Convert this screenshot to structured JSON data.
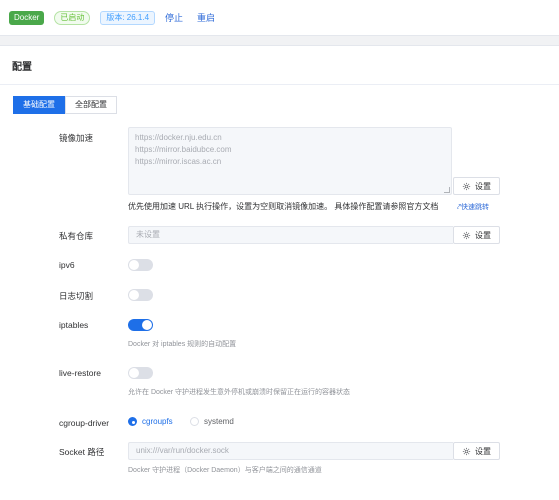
{
  "topbar": {
    "app_tag": "Docker",
    "status_tag": "已启动",
    "version_tag": "版本: 26.1.4",
    "stop_label": "停止",
    "restart_label": "重启"
  },
  "card": {
    "title": "配置"
  },
  "tabs": [
    {
      "label": "基础配置",
      "active": true
    },
    {
      "label": "全部配置",
      "active": false
    }
  ],
  "mirror": {
    "label": "镜像加速",
    "lines": [
      "https://docker.nju.edu.cn",
      "https://mirror.baidubce.com",
      "https://mirror.iscas.ac.cn"
    ],
    "settings_label": "设置",
    "note": "优先使用加速 URL 执行操作，设置为空则取消镜像加速。 具体操作配置请参照官方文档",
    "quick_link": "快速跳转"
  },
  "registry": {
    "label": "私有仓库",
    "placeholder": "未设置",
    "settings_label": "设置"
  },
  "ipv6": {
    "label": "ipv6",
    "enabled": false
  },
  "log_rotate": {
    "label": "日志切割",
    "enabled": false
  },
  "iptables": {
    "label": "iptables",
    "enabled": true,
    "help": "Docker 对 iptables 规则的自动配置"
  },
  "live_restore": {
    "label": "live-restore",
    "enabled": false,
    "help": "允许在 Docker 守护进程发生意外停机或崩溃时保留正在运行的容器状态"
  },
  "cgroup": {
    "label": "cgroup-driver",
    "options": [
      "cgroupfs",
      "systemd"
    ],
    "selected": "cgroupfs"
  },
  "socket": {
    "label": "Socket 路径",
    "value": "unix:///var/run/docker.sock",
    "settings_label": "设置",
    "help": "Docker 守护进程（Docker Daemon）与客户端之间的通信通道"
  },
  "colors": {
    "primary": "#1e6fe8",
    "success": "#67c23a",
    "docker_green": "#4aa84a"
  },
  "icons": {
    "settings": "gear-icon",
    "link": "link-icon"
  }
}
